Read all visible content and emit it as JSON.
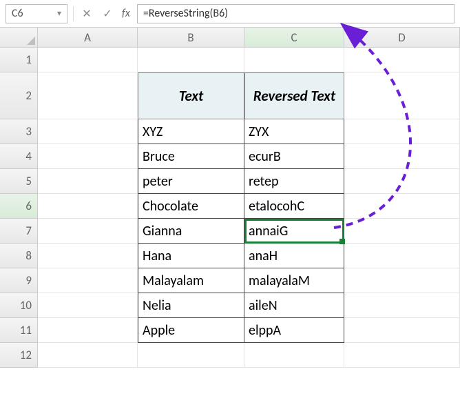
{
  "formula_bar": {
    "name_box": "C6",
    "cancel_icon": "✕",
    "confirm_icon": "✓",
    "fx_label": "fx",
    "formula": "=ReverseString(B6)"
  },
  "columns": [
    "A",
    "B",
    "C",
    "D"
  ],
  "row_numbers": [
    "1",
    "2",
    "3",
    "4",
    "5",
    "6",
    "7",
    "8",
    "9",
    "10",
    "11",
    "12"
  ],
  "headers": {
    "text": "Text",
    "reversed": "Reversed Text"
  },
  "rows": [
    {
      "b": "XYZ",
      "c": "ZYX"
    },
    {
      "b": "Bruce",
      "c": "ecurB"
    },
    {
      "b": "peter",
      "c": "retep"
    },
    {
      "b": "Chocolate",
      "c": "etalocohC"
    },
    {
      "b": "Gianna",
      "c": "annaiG"
    },
    {
      "b": "Hana",
      "c": "anaH"
    },
    {
      "b": "Malayalam",
      "c": "malayalaM"
    },
    {
      "b": "Nelia",
      "c": "aileN"
    },
    {
      "b": "Apple",
      "c": "elppA"
    }
  ],
  "selected": {
    "row": 6,
    "col": "C"
  }
}
